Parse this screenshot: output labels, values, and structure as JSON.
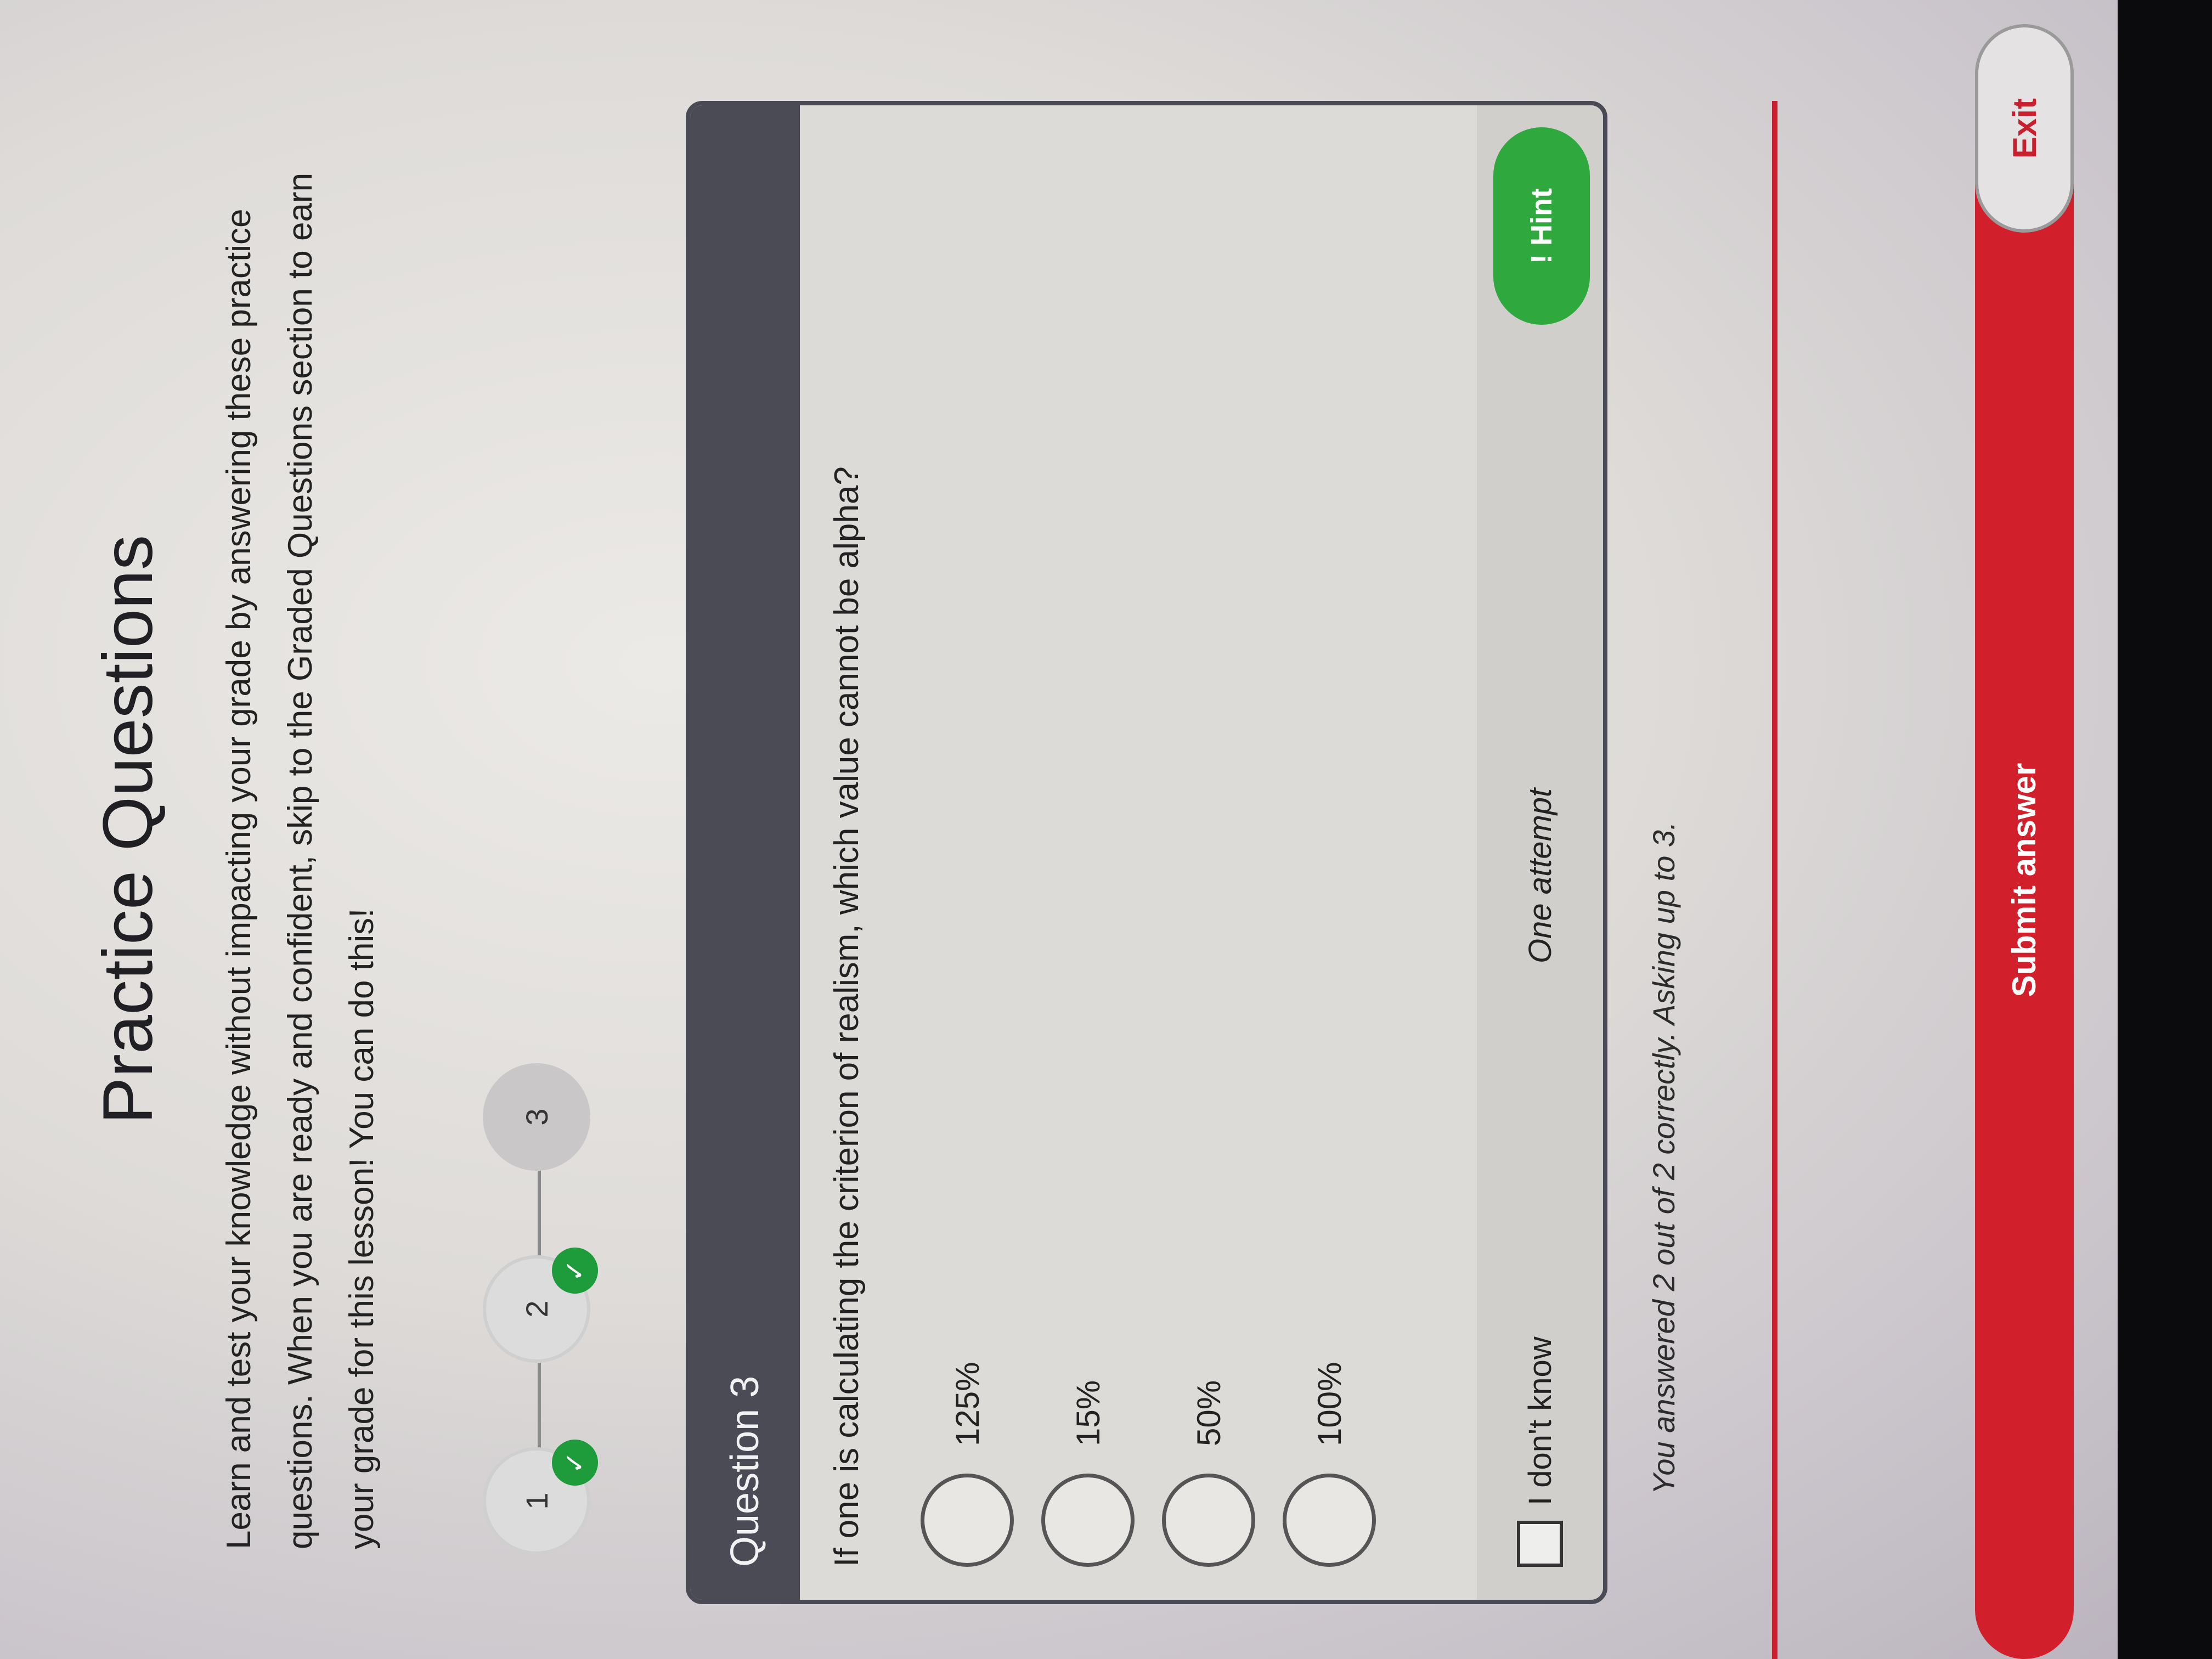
{
  "page": {
    "title": "Practice Questions",
    "intro": "Learn and test your knowledge without impacting your grade by answering these practice questions. When you are ready and confident, skip to the Graded Questions section to earn your grade for this lesson! You can do this!"
  },
  "stepper": {
    "steps": [
      {
        "label": "1",
        "status": "correct"
      },
      {
        "label": "2",
        "status": "correct"
      },
      {
        "label": "3",
        "status": "current"
      }
    ],
    "check_glyph": "✓"
  },
  "question": {
    "header": "Question 3",
    "text": "If one is calculating the criterion of realism, which value cannot be alpha?",
    "options": [
      {
        "label": "125%"
      },
      {
        "label": "15%"
      },
      {
        "label": "50%"
      },
      {
        "label": "100%"
      }
    ],
    "dont_know_label": "I don't know",
    "attempt_note": "One attempt",
    "hint_label": "! Hint"
  },
  "status": {
    "answered_text": "You answered 2 out of 2 correctly. Asking up to 3."
  },
  "actions": {
    "submit_label": "Submit answer",
    "exit_label": "Exit"
  },
  "colors": {
    "accent_red": "#d1202c",
    "hint_green": "#2fa83e",
    "check_green": "#1e9b3a",
    "header_dark": "#4b4b55"
  }
}
